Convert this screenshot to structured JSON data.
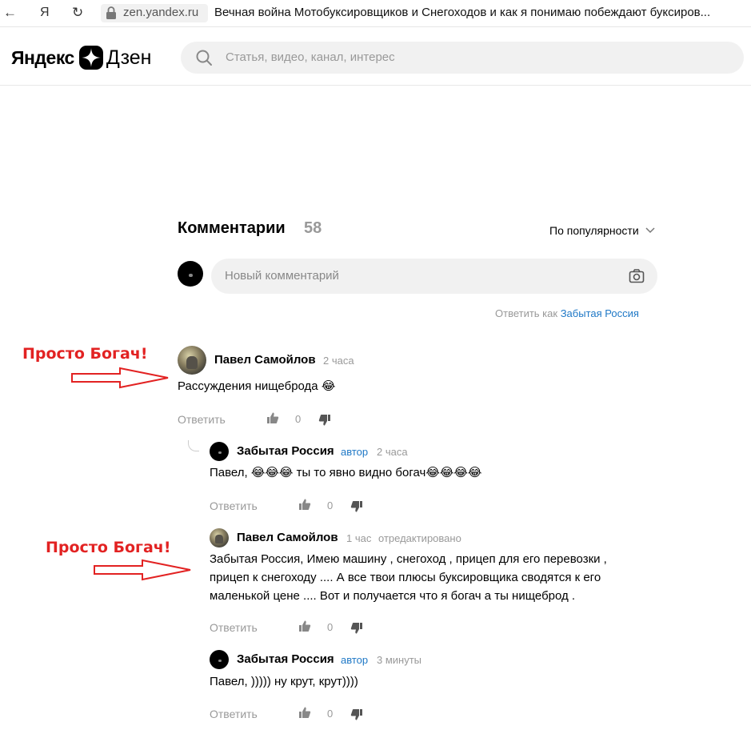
{
  "browser": {
    "back_glyph": "←",
    "ya_glyph": "Я",
    "reload_glyph": "↻",
    "url": "zen.yandex.ru",
    "title": "Вечная война Мотобуксировщиков и Снегоходов и как я понимаю побеждают буксиров..."
  },
  "header": {
    "logo_left": "Яндекс",
    "logo_right": "Дзен",
    "search_placeholder": "Статья, видео, канал, интерес"
  },
  "comments_header": {
    "title": "Комментарии",
    "count": "58",
    "sort_label": "По популярности"
  },
  "new_comment": {
    "placeholder": "Новый комментарий",
    "reply_as_prefix": "Ответить как",
    "reply_as_name": "Забытая Россия"
  },
  "comments": [
    {
      "author": "Павел Самойлов",
      "time": "2 часа",
      "text": "Рассуждения нищеброда 😂",
      "reply_label": "Ответить",
      "likes": "0"
    },
    {
      "author": "Забытая Россия",
      "author_tag": "автор",
      "time": "2 часа",
      "text": "Павел, 😂😂😂 ты то явно видно богач😂😂😂😂",
      "reply_label": "Ответить",
      "likes": "0"
    },
    {
      "author": "Павел Самойлов",
      "time": "1 час",
      "edited": "отредактировано",
      "text_lines": [
        "Забытая Россия, Имею машину , снегоход , прицеп для его перевозки ,",
        "прицеп к снегоходу .... А все твои плюсы буксировщика сводятся к его",
        "маленькой цене .... Вот и получается что я богач а ты нищеброд ."
      ],
      "reply_label": "Ответить",
      "likes": "0"
    },
    {
      "author": "Забытая Россия",
      "author_tag": "автор",
      "time": "3 минуты",
      "text": "Павел, ))))) ну крут, крут))))",
      "reply_label": "Ответить",
      "likes": "0"
    }
  ],
  "annotations": [
    "Просто Богач!",
    "Просто Богач!"
  ],
  "colors": {
    "link_blue": "#1f78c6",
    "annotation_red": "#e22222",
    "muted_gray": "#999999"
  },
  "icons": [
    "back-arrow-icon",
    "yandex-icon",
    "reload-icon",
    "lock-icon",
    "logo-star-icon",
    "search-icon",
    "chevron-down-icon",
    "camera-icon",
    "thumb-up-icon",
    "thumb-down-icon"
  ]
}
